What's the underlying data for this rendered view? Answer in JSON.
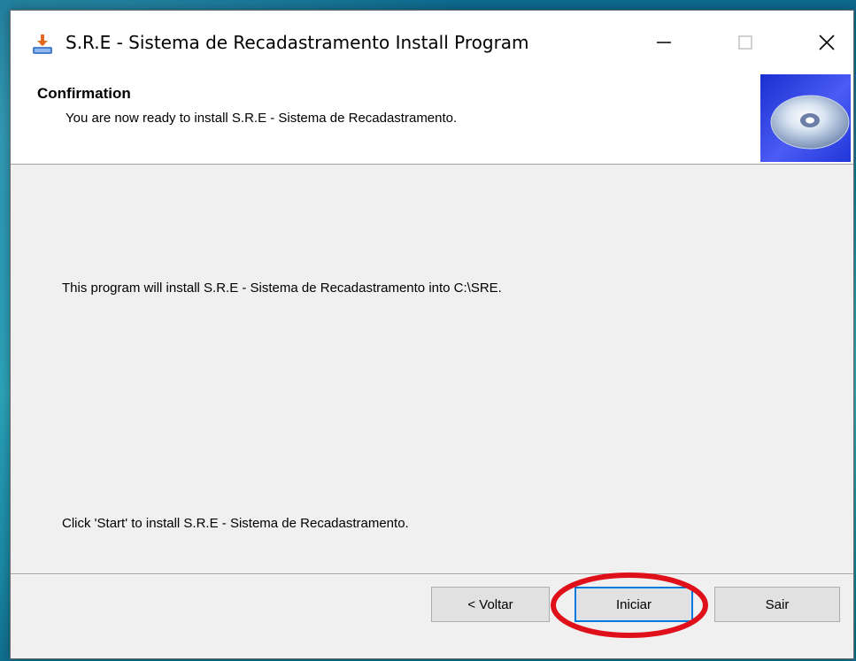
{
  "window": {
    "title": "S.R.E - Sistema de Recadastramento Install Program",
    "controls": {
      "minimize": "minimize",
      "maximize": "maximize",
      "close": "close"
    }
  },
  "header": {
    "title": "Confirmation",
    "subtitle": "You are now ready to install S.R.E - Sistema de Recadastramento.",
    "graphic": "cd-disc-icon"
  },
  "body": {
    "line1": "This program will install S.R.E - Sistema de Recadastramento into C:\\SRE.",
    "line2": "Click 'Start' to install S.R.E - Sistema de Recadastramento."
  },
  "buttons": {
    "back_label": "< Voltar",
    "start_label": "Iniciar",
    "exit_label": "Sair"
  },
  "annotation": {
    "highlight_color": "#e0101a",
    "highlight_target": "start-button"
  },
  "colors": {
    "focus_border": "#0078d7",
    "header_graphic": "#2a3de0"
  }
}
